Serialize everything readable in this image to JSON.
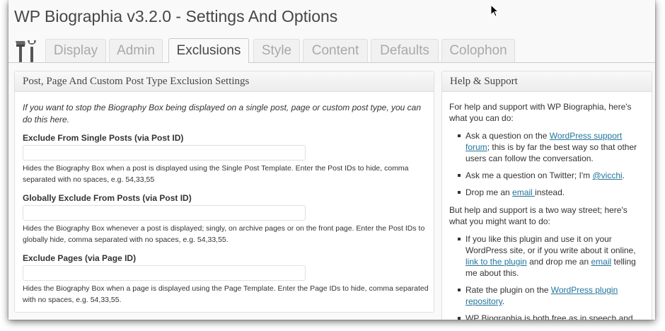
{
  "page": {
    "title": "WP Biographia v3.2.0 - Settings And Options"
  },
  "tabs": [
    {
      "label": "Display",
      "active": false
    },
    {
      "label": "Admin",
      "active": false
    },
    {
      "label": "Exclusions",
      "active": true
    },
    {
      "label": "Style",
      "active": false
    },
    {
      "label": "Content",
      "active": false
    },
    {
      "label": "Defaults",
      "active": false
    },
    {
      "label": "Colophon",
      "active": false
    }
  ],
  "main_panel": {
    "title": "Post, Page And Custom Post Type Exclusion Settings",
    "intro": "If you want to stop the Biography Box being displayed on a single post, page or custom post type, you can do this here.",
    "fields": [
      {
        "label": "Exclude From Single Posts (via Post ID)",
        "value": "",
        "description": "Hides the Biography Box when a post is displayed using the Single Post Template. Enter the Post IDs to hide, comma separated with no spaces, e.g. 54,33,55"
      },
      {
        "label": "Globally Exclude From Posts (via Post ID)",
        "value": "",
        "description": "Hides the Biography Box whenever a post is displayed; singly, on archive pages or on the front page. Enter the Post IDs to globally hide, comma separated with no spaces, e.g. 54,33,55."
      },
      {
        "label": "Exclude Pages (via Page ID)",
        "value": "",
        "description": "Hides the Biography Box when a page is displayed using the Page Template. Enter the Page IDs to hide, comma separated with no spaces, e.g. 54,33,55."
      }
    ]
  },
  "support_panel": {
    "title": "Help & Support",
    "intro": "For help and support with WP Biographia, here's what you can do:",
    "items1": {
      "i0": {
        "pre": "Ask a question on the ",
        "link": "WordPress support forum",
        "post": "; this is by far the best way so that other users can follow the conversation."
      },
      "i1": {
        "pre": "Ask me a question on Twitter; I'm ",
        "link": "@vicchi",
        "post": "."
      },
      "i2": {
        "pre": "Drop me an ",
        "link": "email ",
        "post": "instead."
      }
    },
    "middle": "But help and support is a two way street; here's what you might want to do:",
    "items2": {
      "i0": {
        "pre": "If you like this plugin and use it on your WordPress site, or if you write about it online, ",
        "link1": "link to the plugin",
        "mid": " and drop me an ",
        "link2": "email",
        "post": " telling me about this."
      },
      "i1": {
        "pre": "Rate the plugin on the ",
        "link": "WordPress plugin repository",
        "post": "."
      },
      "i2": {
        "pre": "WP Biographia is both free as in speech and"
      }
    }
  },
  "icons": {
    "tools": "tools-icon",
    "cursor": "mouse-pointer-icon"
  },
  "colors": {
    "link": "#21759b",
    "active_tab_text": "#464646",
    "inactive_tab_text": "#a9a9a9"
  }
}
